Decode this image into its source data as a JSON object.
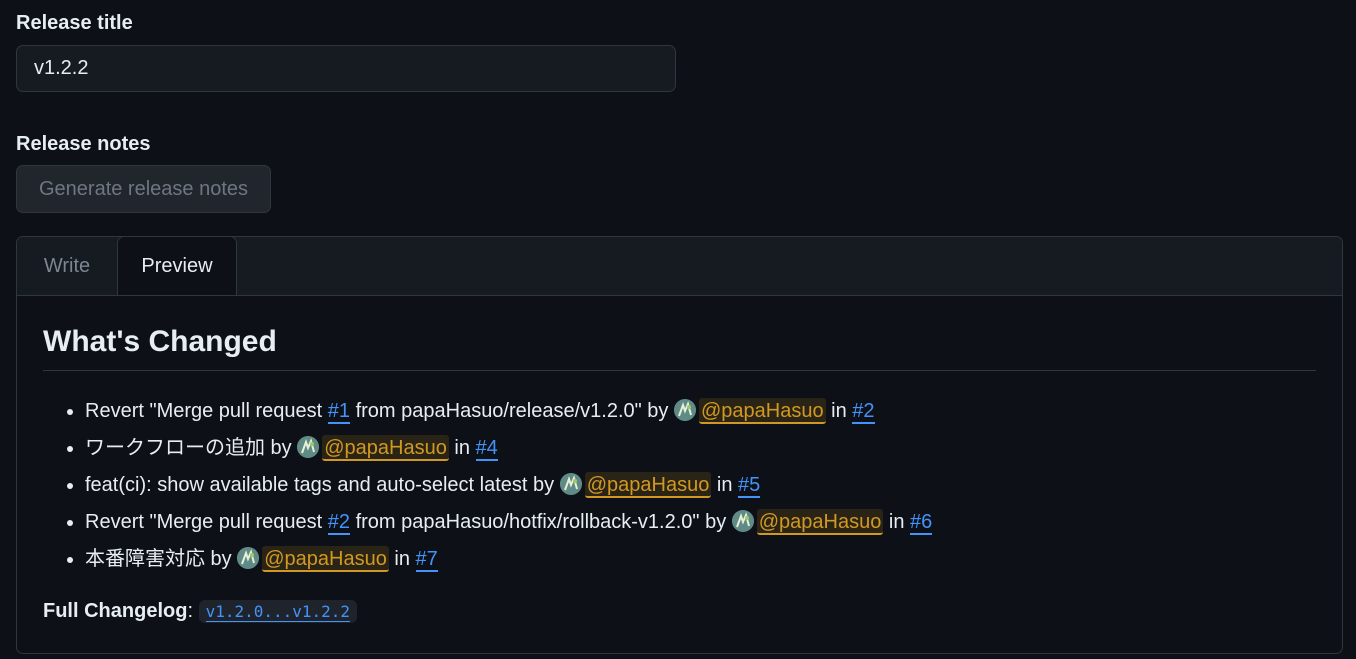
{
  "release_title": {
    "label": "Release title",
    "value": "v1.2.2"
  },
  "release_notes": {
    "label": "Release notes",
    "generate_button": "Generate release notes"
  },
  "editor": {
    "tabs": [
      {
        "label": "Write",
        "active": false
      },
      {
        "label": "Preview",
        "active": true
      }
    ]
  },
  "preview": {
    "heading": "What's Changed",
    "items": [
      {
        "pre": "Revert \"Merge pull request ",
        "ref": "#1",
        "mid": " from papaHasuo/release/v1.2.0\" by ",
        "user": "@papaHasuo",
        "in": " in ",
        "pr": "#2"
      },
      {
        "pre": "ワークフローの追加 by ",
        "ref": "",
        "mid": "",
        "user": "@papaHasuo",
        "in": " in ",
        "pr": "#4"
      },
      {
        "pre": "feat(ci): show available tags and auto-select latest by ",
        "ref": "",
        "mid": "",
        "user": "@papaHasuo",
        "in": " in ",
        "pr": "#5"
      },
      {
        "pre": "Revert \"Merge pull request ",
        "ref": "#2",
        "mid": " from papaHasuo/hotfix/rollback-v1.2.0\" by ",
        "user": "@papaHasuo",
        "in": " in ",
        "pr": "#6"
      },
      {
        "pre": "本番障害対応 by ",
        "ref": "",
        "mid": "",
        "user": "@papaHasuo",
        "in": " in ",
        "pr": "#7"
      }
    ],
    "changelog_label": "Full Changelog",
    "changelog_sep": ": ",
    "changelog_link": "v1.2.0...v1.2.2"
  },
  "colors": {
    "background": "#0d1117",
    "link": "#4493f8",
    "mention": "#d29922",
    "border": "#30363d"
  }
}
